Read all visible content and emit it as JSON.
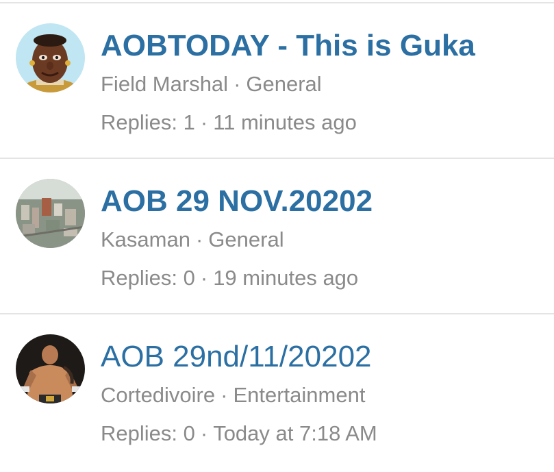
{
  "threads": [
    {
      "title": "AOBTODAY - This is Guka",
      "unread": true,
      "author": "Field Marshal",
      "forum": "General",
      "replies_label": "Replies: 1",
      "time": "11 minutes ago",
      "avatar": "cartoon-face-avatar"
    },
    {
      "title": "AOB 29 NOV.20202",
      "unread": true,
      "author": "Kasaman",
      "forum": "General",
      "replies_label": "Replies: 0",
      "time": "19 minutes ago",
      "avatar": "city-aerial-avatar"
    },
    {
      "title": "AOB 29nd/11/20202",
      "unread": false,
      "author": "Cortedivoire",
      "forum": "Entertainment",
      "replies_label": "Replies: 0",
      "time": "Today at 7:18 AM",
      "avatar": "wrestler-avatar"
    }
  ],
  "separator": "·",
  "colors": {
    "title": "#2b6fa3",
    "meta": "#8a8a8a",
    "divider": "#e4e4e4"
  }
}
